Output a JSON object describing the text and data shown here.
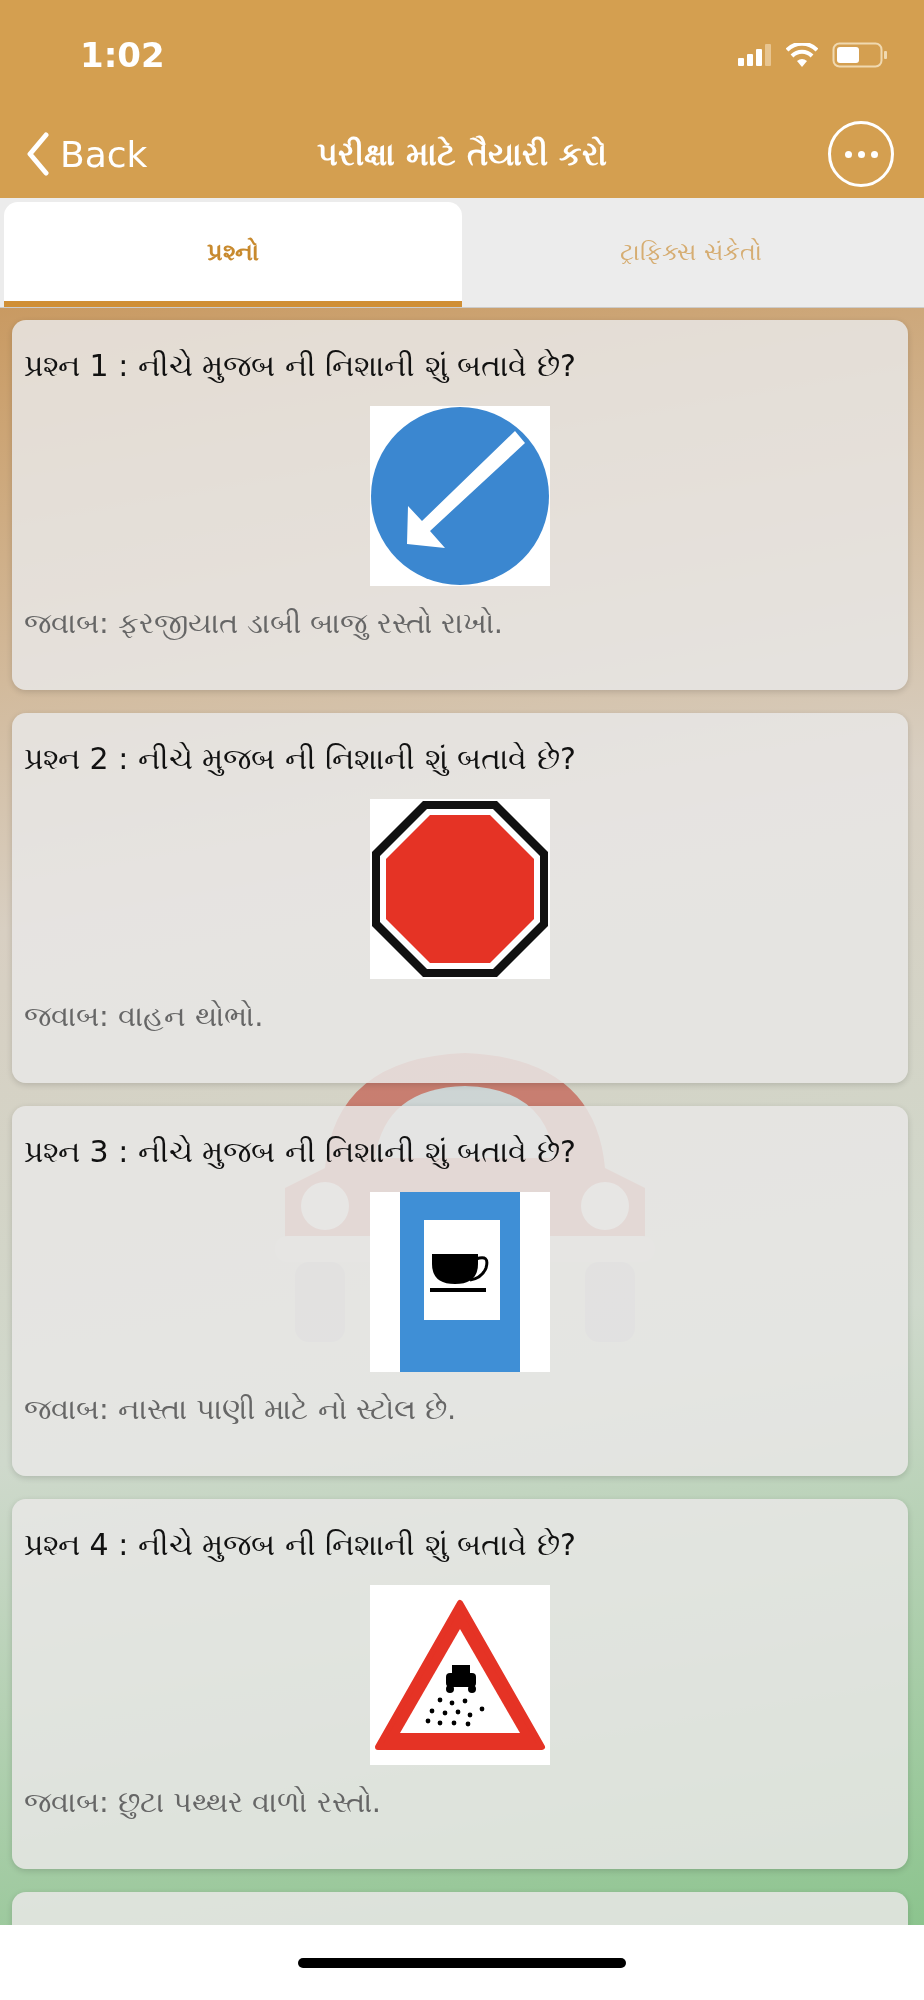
{
  "status_bar": {
    "time": "1:02"
  },
  "nav": {
    "back": "Back",
    "title": "પરીક્ષા માટે તૈયારી કરો"
  },
  "tabs": [
    {
      "label": "પ્રશ્નો",
      "selected": true
    },
    {
      "label": "ટ્રાફિક્સ સંકેતો",
      "selected": false
    }
  ],
  "questions": [
    {
      "question": "પ્રશ્ન 1 : નીચે મુજબ ની નિશાની શું બતાવે છે?",
      "kind": "keep_left",
      "answer": "જવાબ: ફરજીયાત ડાબી બાજુ રસ્તો રાખો."
    },
    {
      "question": "પ્રશ્ન 2 : નીચે મુજબ ની નિશાની શું બતાવે છે?",
      "kind": "stop",
      "answer": "જવાબ: વાહન થોભો."
    },
    {
      "question": "પ્રશ્ન 3 : નીચે મુજબ ની નિશાની શું બતાવે છે?",
      "kind": "refreshment",
      "answer": "જવાબ: નાસ્તા પાણી માટે નો સ્ટોલ છે."
    },
    {
      "question": "પ્રશ્ન 4 : નીચે મુજબ ની નિશાની શું બતાવે છે?",
      "kind": "loose_gravel",
      "answer": "જવાબ: છુટા પથ્થર વાળો રસ્તો."
    }
  ],
  "partial_card": true
}
